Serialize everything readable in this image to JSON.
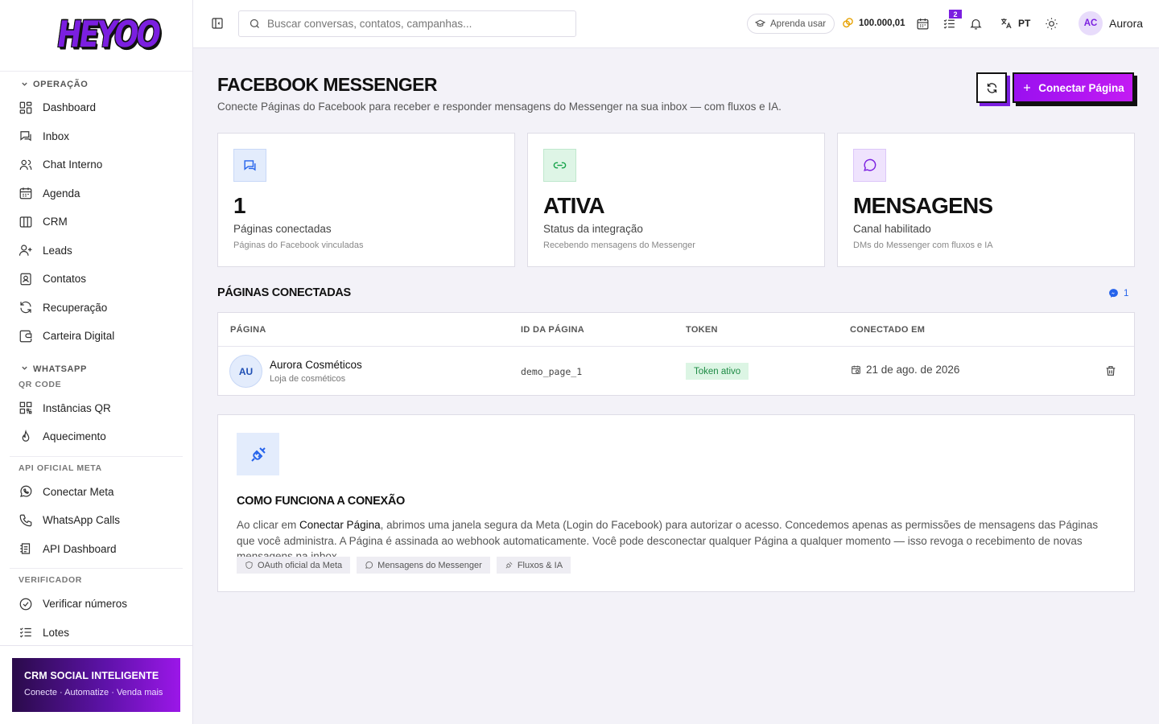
{
  "brand": {
    "logo_text": "HEYOO"
  },
  "sidebar": {
    "sections": [
      {
        "title": "OPERAÇÃO",
        "items": [
          "Dashboard",
          "Inbox",
          "Chat Interno",
          "Agenda",
          "CRM",
          "Leads",
          "Contatos",
          "Recuperação",
          "Carteira Digital"
        ]
      },
      {
        "title": "WHATSAPP",
        "sub": "QR CODE",
        "items": [
          "Instâncias QR",
          "Aquecimento"
        ]
      },
      {
        "sub": "API OFICIAL META",
        "items": [
          "Conectar Meta",
          "WhatsApp Calls",
          "API Dashboard"
        ]
      },
      {
        "sub": "VERIFICADOR",
        "items": [
          "Verificar números",
          "Lotes"
        ]
      }
    ],
    "promo": {
      "title": "CRM SOCIAL INTELIGENTE",
      "subtitle": "Conecte · Automatize · Venda mais"
    }
  },
  "topbar": {
    "search_placeholder": "Buscar conversas, contatos, campanhas...",
    "learn_label": "Aprenda usar",
    "coins": "100.000,01",
    "tasks_badge": "2",
    "language": "PT",
    "user_initials": "AC",
    "user_name": "Aurora"
  },
  "page": {
    "title": "FACEBOOK MESSENGER",
    "subtitle": "Conecte Páginas do Facebook para receber e responder mensagens do Messenger na sua inbox — com fluxos e IA.",
    "connect_label": "Conectar Página"
  },
  "stats": [
    {
      "value": "1",
      "label": "Páginas conectadas",
      "desc": "Páginas do Facebook vinculadas",
      "color": "#2563eb",
      "bg": "#e3ecfc"
    },
    {
      "value": "ATIVA",
      "label": "Status da integração",
      "desc": "Recebendo mensagens do Messenger",
      "color": "#16a34a",
      "bg": "#def5e6"
    },
    {
      "value": "MENSAGENS",
      "label": "Canal habilitado",
      "desc": "DMs do Messenger com fluxos e IA",
      "color": "#7b1fe0",
      "bg": "#efe3fd"
    }
  ],
  "pages_section": {
    "title": "PÁGINAS CONECTADAS",
    "count": "1",
    "headers": [
      "PÁGINA",
      "ID DA PÁGINA",
      "TOKEN",
      "CONECTADO EM"
    ],
    "rows": [
      {
        "initials": "AU",
        "name": "Aurora Cosméticos",
        "sub": "Loja de cosméticos",
        "page_id": "demo_page_1",
        "token": "Token ativo",
        "connected_at": "21 de ago. de 2026"
      }
    ]
  },
  "how": {
    "title": "COMO FUNCIONA A CONEXÃO",
    "text_prefix": "Ao clicar em ",
    "text_strong": "Conectar Página",
    "text_suffix": ", abrimos uma janela segura da Meta (Login do Facebook) para autorizar o acesso. Concedemos apenas as permissões de mensagens das Páginas que você administra. A Página é assinada ao webhook automaticamente. Você pode desconectar qualquer Página a qualquer momento — isso revoga o recebimento de novas mensagens na inbox.",
    "chips": [
      "OAuth oficial da Meta",
      "Mensagens do Messenger",
      "Fluxos & IA"
    ]
  },
  "icons": {
    "nav": [
      "dashboard-icon",
      "inbox-icon",
      "chat-icon",
      "calendar-icon",
      "kanban-icon",
      "user-plus-icon",
      "contact-book-icon",
      "refresh-icon",
      "wallet-icon",
      "qr-icon",
      "flame-icon",
      "whatsapp-icon",
      "phone-icon",
      "api-icon",
      "check-circle-icon",
      "list-check-icon"
    ]
  }
}
